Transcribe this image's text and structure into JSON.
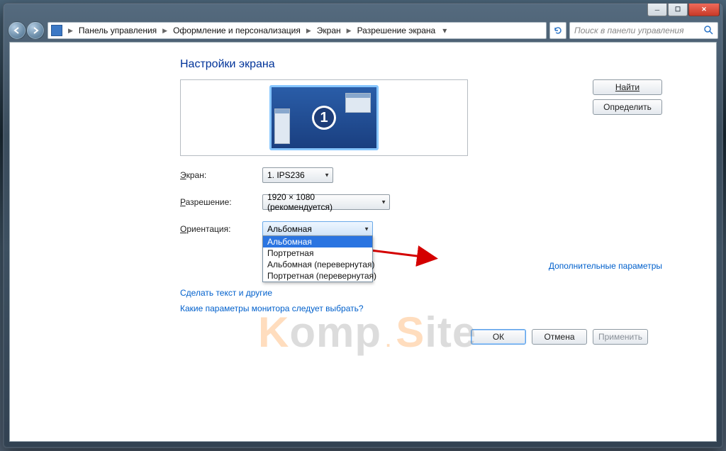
{
  "breadcrumb": {
    "items": [
      "Панель управления",
      "Оформление и персонализация",
      "Экран",
      "Разрешение экрана"
    ]
  },
  "search": {
    "placeholder": "Поиск в панели управления"
  },
  "page": {
    "title": "Настройки экрана"
  },
  "preview": {
    "monitor_number": "1"
  },
  "buttons": {
    "find": "Найти",
    "detect": "Определить",
    "ok": "ОК",
    "cancel": "Отмена",
    "apply": "Применить"
  },
  "form": {
    "display_label": "Экран:",
    "display_value": "1. IPS236",
    "resolution_label": "Разрешение:",
    "resolution_value": "1920 × 1080 (рекомендуется)",
    "orientation_label": "Ориентация:",
    "orientation_value": "Альбомная",
    "orientation_options": [
      "Альбомная",
      "Портретная",
      "Альбомная (перевернутая)",
      "Портретная (перевернутая)"
    ]
  },
  "links": {
    "advanced": "Дополнительные параметры",
    "text_size_partial": "Сделать текст и другие",
    "which_monitor": "Какие параметры монитора следует выбрать?"
  },
  "watermark": {
    "k": "K",
    "omp": "omp",
    "dot": ".",
    "s": "S",
    "ite": "ite"
  }
}
